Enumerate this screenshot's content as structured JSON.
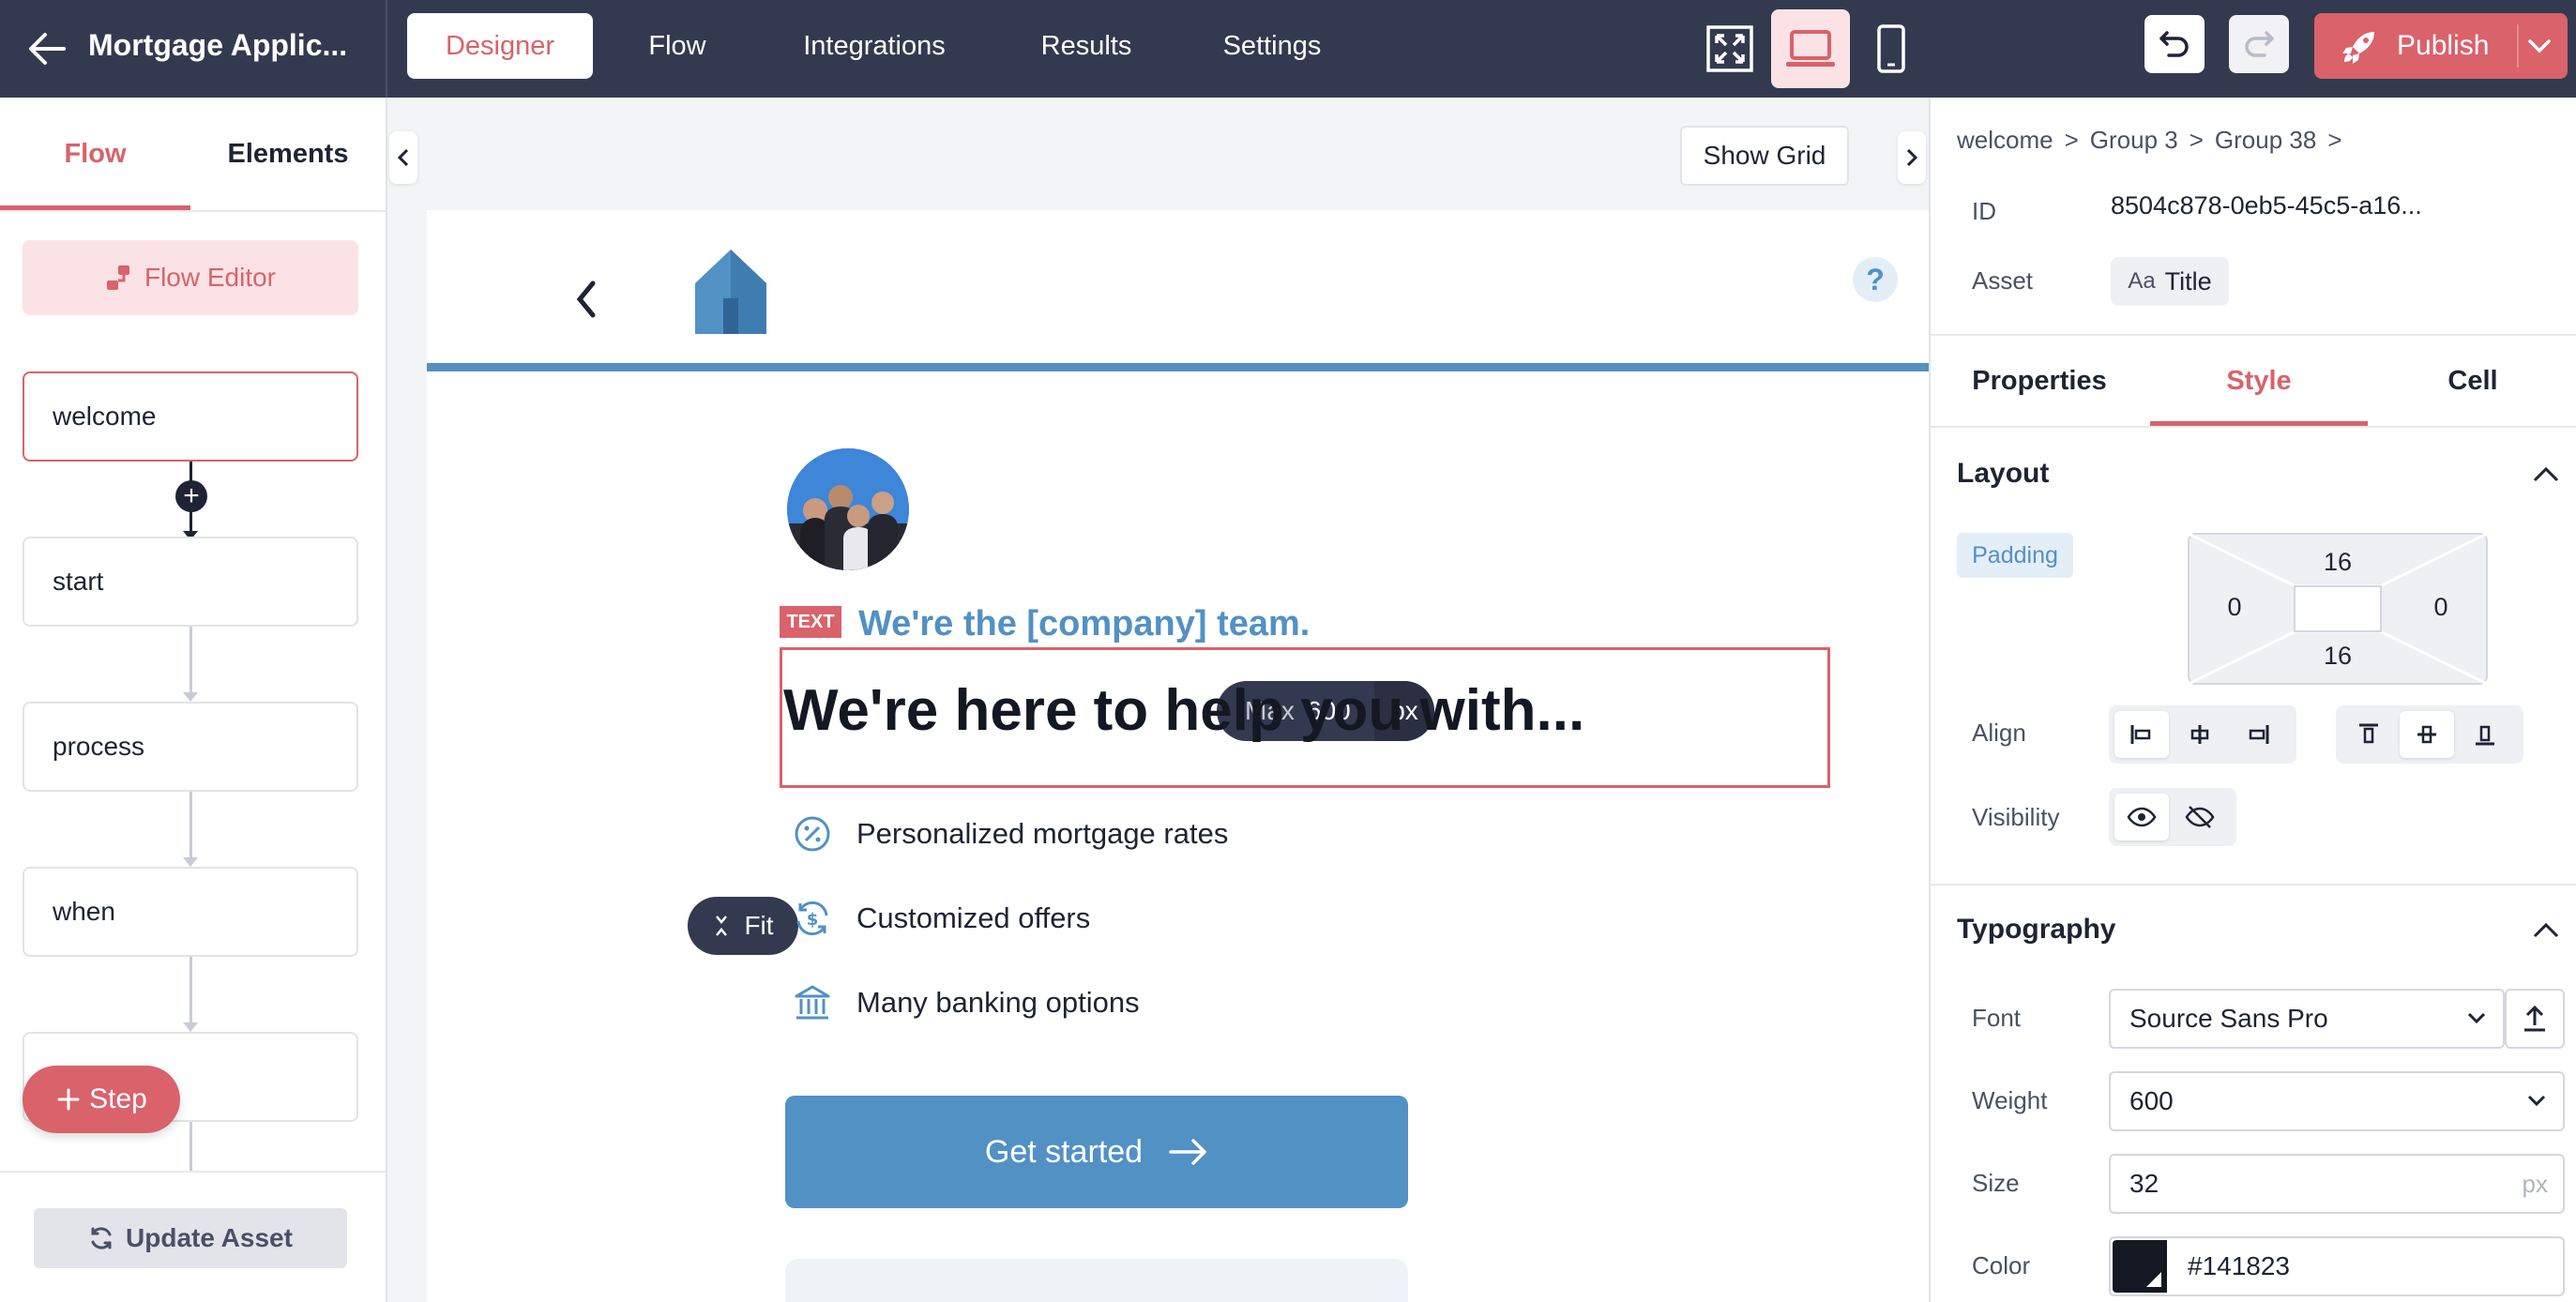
{
  "topbar": {
    "title": "Mortgage Applic...",
    "tabs": [
      {
        "label": "Designer",
        "active": true
      },
      {
        "label": "Flow",
        "active": false
      },
      {
        "label": "Integrations",
        "active": false
      },
      {
        "label": "Results",
        "active": false
      },
      {
        "label": "Settings",
        "active": false
      }
    ],
    "view_modes": [
      "fullscreen-icon",
      "laptop-icon",
      "mobile-icon"
    ],
    "active_view": "laptop-icon",
    "publish_label": "Publish"
  },
  "left_panel": {
    "tabs": [
      {
        "label": "Flow",
        "active": true
      },
      {
        "label": "Elements",
        "active": false
      }
    ],
    "flow_editor_label": "Flow Editor",
    "steps": [
      {
        "label": "welcome",
        "selected": true
      },
      {
        "label": "start",
        "selected": false
      },
      {
        "label": "process",
        "selected": false
      },
      {
        "label": "when",
        "selected": false
      },
      {
        "label": "",
        "selected": false
      }
    ],
    "add_step_label": "Step",
    "update_asset_label": "Update Asset"
  },
  "canvas": {
    "show_grid_label": "Show Grid",
    "max_pill": {
      "prefix": "Max",
      "value": "600",
      "unit": "px"
    },
    "fit_label": "Fit",
    "text_tag": "TEXT",
    "subtitle": "We're the [company] team.",
    "heading": "We're here to help you with...",
    "features": [
      {
        "icon": "percent-icon",
        "label": "Personalized mortgage rates"
      },
      {
        "icon": "dollar-cycle-icon",
        "label": "Customized offers"
      },
      {
        "icon": "bank-icon",
        "label": "Many banking options"
      }
    ],
    "cta_label": "Get started",
    "help_label": "?"
  },
  "right_panel": {
    "breadcrumb": [
      "welcome",
      "Group 3",
      "Group 38"
    ],
    "breadcrumb_sep": ">",
    "id_label": "ID",
    "id_value": "8504c878-0eb5-45c5-a16...",
    "asset_label": "Asset",
    "asset_value": "Title",
    "asset_icon_text": "Aa",
    "tabs": [
      {
        "label": "Properties",
        "active": false
      },
      {
        "label": "Style",
        "active": true
      },
      {
        "label": "Cell",
        "active": false
      }
    ],
    "layout": {
      "title": "Layout",
      "padding_label": "Padding",
      "padding": {
        "top": "16",
        "right": "0",
        "bottom": "16",
        "left": "0"
      },
      "align_label": "Align",
      "visibility_label": "Visibility"
    },
    "typography": {
      "title": "Typography",
      "font_label": "Font",
      "font_value": "Source Sans Pro",
      "weight_label": "Weight",
      "weight_value": "600",
      "size_label": "Size",
      "size_value": "32",
      "size_unit": "px",
      "color_label": "Color",
      "color_value": "#141823"
    }
  },
  "colors": {
    "topbar_bg": "#333a4f",
    "accent": "#d9626b",
    "accent_light": "#fbe3e5",
    "brand_blue": "#5191c4",
    "text_dark": "#141823"
  }
}
